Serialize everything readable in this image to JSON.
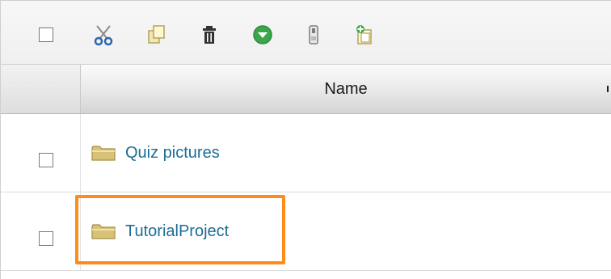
{
  "toolbar": {
    "icons": [
      "cut-icon",
      "copy-icon",
      "delete-icon",
      "move-down-icon",
      "download-icon",
      "paste-icon"
    ]
  },
  "table": {
    "column_name": "Name",
    "rows": [
      {
        "label": "Quiz pictures",
        "icon": "folder-icon"
      },
      {
        "label": "TutorialProject",
        "icon": "folder-icon",
        "highlighted": true
      }
    ]
  },
  "colors": {
    "link": "#1a6e96",
    "highlight": "#ff8c1a"
  }
}
